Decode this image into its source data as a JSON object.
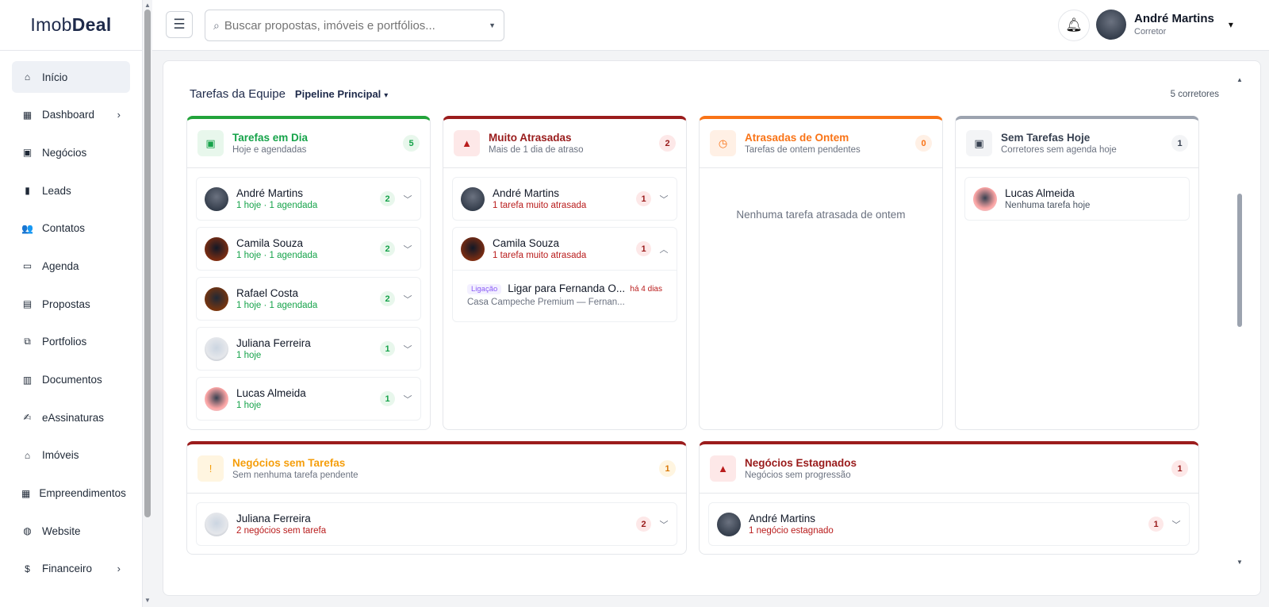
{
  "app": {
    "logo_light": "Imob",
    "logo_bold": "Deal"
  },
  "sidebar": {
    "items": [
      {
        "label": "Início",
        "icon": "home-icon",
        "glyph": "⌂",
        "active": true,
        "has_children": false
      },
      {
        "label": "Dashboard",
        "icon": "dashboard-icon",
        "glyph": "▦",
        "active": false,
        "has_children": true
      },
      {
        "label": "Negócios",
        "icon": "deals-icon",
        "glyph": "▣",
        "active": false,
        "has_children": false
      },
      {
        "label": "Leads",
        "icon": "bar-chart-icon",
        "glyph": "▮",
        "active": false,
        "has_children": false
      },
      {
        "label": "Contatos",
        "icon": "users-icon",
        "glyph": "👥",
        "active": false,
        "has_children": false
      },
      {
        "label": "Agenda",
        "icon": "calendar-icon",
        "glyph": "▭",
        "active": false,
        "has_children": false
      },
      {
        "label": "Propostas",
        "icon": "file-icon",
        "glyph": "▤",
        "active": false,
        "has_children": false
      },
      {
        "label": "Portfolios",
        "icon": "copy-icon",
        "glyph": "⧉",
        "active": false,
        "has_children": false
      },
      {
        "label": "Documentos",
        "icon": "document-icon",
        "glyph": "▥",
        "active": false,
        "has_children": false
      },
      {
        "label": "eAssinaturas",
        "icon": "signature-icon",
        "glyph": "✍",
        "active": false,
        "has_children": false
      },
      {
        "label": "Imóveis",
        "icon": "house-icon",
        "glyph": "⌂",
        "active": false,
        "has_children": false
      },
      {
        "label": "Empreendimentos",
        "icon": "building-icon",
        "glyph": "▦",
        "active": false,
        "has_children": false
      },
      {
        "label": "Website",
        "icon": "globe-icon",
        "glyph": "◍",
        "active": false,
        "has_children": false
      },
      {
        "label": "Financeiro",
        "icon": "dollar-icon",
        "glyph": "$",
        "active": false,
        "has_children": true
      }
    ]
  },
  "topbar": {
    "search_placeholder": "Buscar propostas, imóveis e portfólios...",
    "user_name": "André Martins",
    "user_role": "Corretor"
  },
  "main": {
    "title": "Tarefas da Equipe",
    "pipeline": "Pipeline Principal",
    "count_text": "5 corretores"
  },
  "columns": [
    {
      "theme": "green",
      "icon": "calendar-check-icon",
      "glyph": "▣",
      "title": "Tarefas em Dia",
      "subtitle": "Hoje e agendadas",
      "badge": "5",
      "rows": [
        {
          "name": "André Martins",
          "sub": "1 hoje · 1 agendada",
          "badge": "2",
          "av": "av1",
          "sub_class": "sub-green",
          "badge_class": "b-green",
          "expanded": false
        },
        {
          "name": "Camila Souza",
          "sub": "1 hoje · 1 agendada",
          "badge": "2",
          "av": "av2",
          "sub_class": "sub-green",
          "badge_class": "b-green",
          "expanded": false
        },
        {
          "name": "Rafael Costa",
          "sub": "1 hoje · 1 agendada",
          "badge": "2",
          "av": "av3",
          "sub_class": "sub-green",
          "badge_class": "b-green",
          "expanded": false
        },
        {
          "name": "Juliana Ferreira",
          "sub": "1 hoje",
          "badge": "1",
          "av": "av4",
          "sub_class": "sub-green",
          "badge_class": "b-green",
          "expanded": false
        },
        {
          "name": "Lucas Almeida",
          "sub": "1 hoje",
          "badge": "1",
          "av": "av5",
          "sub_class": "sub-green",
          "badge_class": "b-green",
          "expanded": false
        }
      ]
    },
    {
      "theme": "red",
      "icon": "alert-icon",
      "glyph": "▲",
      "title": "Muito Atrasadas",
      "subtitle": "Mais de 1 dia de atraso",
      "badge": "2",
      "rows": [
        {
          "name": "André Martins",
          "sub": "1 tarefa muito atrasada",
          "badge": "1",
          "av": "av1",
          "sub_class": "sub-red",
          "badge_class": "b-red",
          "expanded": false
        },
        {
          "name": "Camila Souza",
          "sub": "1 tarefa muito atrasada",
          "badge": "1",
          "av": "av2",
          "sub_class": "sub-red",
          "badge_class": "b-red",
          "expanded": true,
          "task": {
            "tag": "Ligação",
            "title": "Ligar para Fernanda O...",
            "subtitle": "Casa Campeche Premium — Fernan...",
            "age": "há 4 dias"
          }
        }
      ]
    },
    {
      "theme": "orange",
      "icon": "clock-icon",
      "glyph": "◷",
      "title": "Atrasadas de Ontem",
      "subtitle": "Tarefas de ontem pendentes",
      "badge": "0",
      "rows": [],
      "empty": "Nenhuma tarefa atrasada de ontem"
    },
    {
      "theme": "gray",
      "icon": "calendar-x-icon",
      "glyph": "▣",
      "title": "Sem Tarefas Hoje",
      "subtitle": "Corretores sem agenda hoje",
      "badge": "1",
      "rows": [
        {
          "name": "Lucas Almeida",
          "sub": "Nenhuma tarefa hoje",
          "badge": "",
          "av": "av5",
          "sub_class": "sub-gray",
          "badge_class": "",
          "expanded": false,
          "no_chevron": true
        }
      ]
    },
    {
      "theme": "amber",
      "icon": "warning-circle-icon",
      "glyph": "!",
      "title": "Negócios sem Tarefas",
      "subtitle": "Sem nenhuma tarefa pendente",
      "badge": "1",
      "rows": [
        {
          "name": "Juliana Ferreira",
          "sub": "2 negócios sem tarefa",
          "badge": "2",
          "av": "av4",
          "sub_class": "sub-red",
          "badge_class": "b-red",
          "expanded": false
        }
      ]
    },
    {
      "theme": "red",
      "icon": "alert-icon",
      "glyph": "▲",
      "title": "Negócios Estagnados",
      "subtitle": "Negócios sem progressão",
      "badge": "1",
      "rows": [
        {
          "name": "André Martins",
          "sub": "1 negócio estagnado",
          "badge": "1",
          "av": "av1",
          "sub_class": "sub-red",
          "badge_class": "b-red",
          "expanded": false
        }
      ]
    }
  ]
}
